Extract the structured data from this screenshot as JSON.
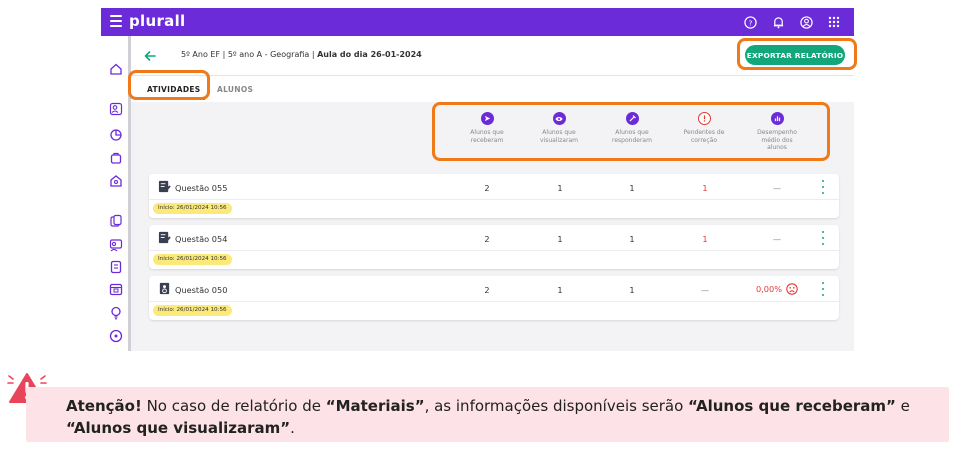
{
  "app": {
    "logo": "plurall"
  },
  "header": {
    "breadcrumb_path": "5º Ano EF | 5º ano A - Geografia |",
    "breadcrumb_current": "Aula do dia 26-01-2024",
    "export_label": "EXPORTAR RELATÓRIO"
  },
  "tabs": {
    "activities": "ATIVIDADES",
    "students": "ALUNOS"
  },
  "stats": [
    {
      "label": "Alunos que\nreceberam",
      "icon": "send-icon",
      "color": "#6c2bd9"
    },
    {
      "label": "Alunos que\nvisualizaram",
      "icon": "eye-icon",
      "color": "#6c2bd9"
    },
    {
      "label": "Alunos que\nresponderam",
      "icon": "pencil-icon",
      "color": "#6c2bd9"
    },
    {
      "label": "Pendentes de\ncorreção",
      "icon": "alert-icon",
      "color": "#e53935"
    },
    {
      "label": "Desempenho\nmédio dos\nalunos",
      "icon": "bar-chart-icon",
      "color": "#6c2bd9"
    }
  ],
  "rows": [
    {
      "title": "Questão 055",
      "received": "2",
      "viewed": "1",
      "answered": "1",
      "pending": "1",
      "performance": "—",
      "start": "Início: 26/01/2024 10:56"
    },
    {
      "title": "Questão 054",
      "received": "2",
      "viewed": "1",
      "answered": "1",
      "pending": "1",
      "performance": "—",
      "start": "Início: 26/01/2024 10:56"
    },
    {
      "title": "Questão 050",
      "received": "2",
      "viewed": "1",
      "answered": "1",
      "pending": "—",
      "performance": "0,00%",
      "start": "Início: 26/01/2024 10:56"
    }
  ],
  "notice": {
    "attention": "Atenção!",
    "text1": " No caso de relatório de ",
    "materials": "“Materiais”",
    "text2": ", as informações disponíveis serão ",
    "received": "“Alunos que receberam”",
    "text3": " e ",
    "viewed": "“Alunos que visualizaram”",
    "text4": "."
  },
  "colors": {
    "brand": "#6c2bd9",
    "accent": "#11a77b",
    "alert": "#e53935",
    "highlight": "#f07a1a",
    "notice_bg": "#fde3e7"
  }
}
